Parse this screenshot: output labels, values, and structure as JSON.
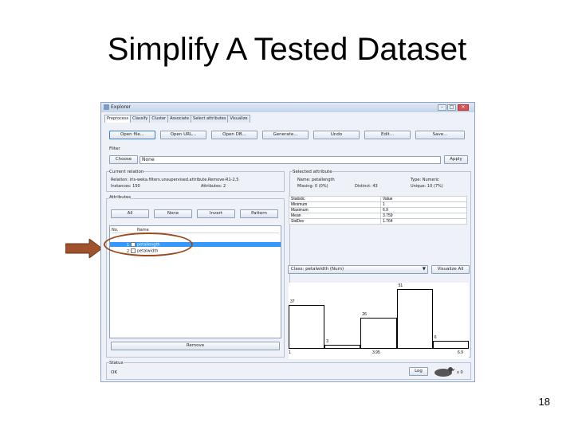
{
  "slide": {
    "title": "Simplify A Tested Dataset",
    "number": "18"
  },
  "window": {
    "title": "Explorer",
    "controls": [
      "–",
      "□",
      "✕"
    ],
    "tabs": [
      "Preprocess",
      "Classify",
      "Cluster",
      "Associate",
      "Select attributes",
      "Visualize"
    ],
    "toolbar": [
      "Open file...",
      "Open URL...",
      "Open DB...",
      "Generate...",
      "Undo",
      "Edit...",
      "Save..."
    ],
    "filter": {
      "label": "Filter",
      "choose": "Choose",
      "value": "None",
      "apply": "Apply"
    },
    "current_relation": {
      "label": "Current relation",
      "relation": "Relation: iris-weka.filters.unsupervised.attribute.Remove-R1-2,5",
      "instances": "Instances: 150",
      "attributes": "Attributes: 2"
    },
    "attributes": {
      "label": "Attributes",
      "buttons": [
        "All",
        "None",
        "Invert",
        "Pattern"
      ],
      "col_no": "No.",
      "col_name": "Name",
      "rows": [
        {
          "no": "1",
          "name": "petallength",
          "selected": true
        },
        {
          "no": "2",
          "name": "petalwidth",
          "selected": false
        }
      ],
      "remove": "Remove"
    },
    "selected_attribute": {
      "label": "Selected attribute",
      "name": "Name: petallength",
      "type": "Type: Numeric",
      "missing": "Missing: 0 (0%)",
      "distinct": "Distinct: 43",
      "unique": "Unique: 10 (7%)",
      "table_headers": [
        "Statistic",
        "Value"
      ],
      "stats": [
        [
          "Minimum",
          "1"
        ],
        [
          "Maximum",
          "6.9"
        ],
        [
          "Mean",
          "3.759"
        ],
        [
          "StdDev",
          "1.764"
        ]
      ]
    },
    "class_select": "Class: petalwidth (Num)",
    "visualize_all": "Visualize All",
    "histogram": {
      "bars": [
        {
          "label": "37",
          "value": 37
        },
        {
          "label": "3",
          "value": 3
        },
        {
          "label": "26",
          "value": 26
        },
        {
          "label": "51",
          "value": 51
        },
        {
          "label": "6",
          "value": 6
        }
      ],
      "axis": [
        "1",
        "3.95",
        "6.9"
      ]
    },
    "status": {
      "label": "Status",
      "text": "OK",
      "log": "Log",
      "count": "x 0"
    }
  }
}
